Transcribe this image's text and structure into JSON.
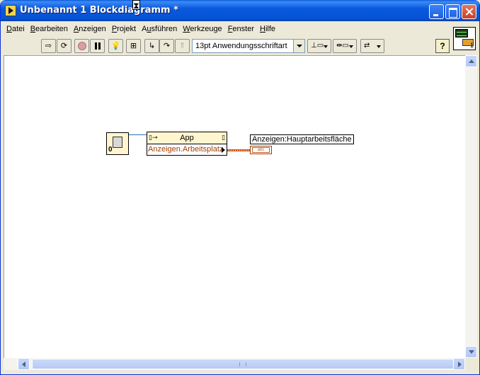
{
  "window": {
    "title": "Unbenannt 1 Blockdiagramm *"
  },
  "menu": [
    {
      "label": "Datei",
      "u": "D"
    },
    {
      "label": "Bearbeiten",
      "u": "B"
    },
    {
      "label": "Anzeigen",
      "u": "A"
    },
    {
      "label": "Projekt",
      "u": "P"
    },
    {
      "label": "Ausführen",
      "u": "u"
    },
    {
      "label": "Werkzeuge",
      "u": "W"
    },
    {
      "label": "Fenster",
      "u": "F"
    },
    {
      "label": "Hilfe",
      "u": "H"
    }
  ],
  "toolbar": {
    "font": "13pt Anwendungsschriftart",
    "help": "?"
  },
  "vi_icon": {
    "connector_label": "1"
  },
  "diagram": {
    "ref_label": "0",
    "prop_class": "App",
    "prop_property": "Anzeigen.Arbeitsplatz",
    "indicator_label": "Anzeigen:Hauptarbeitsfläche",
    "indicator_type": "abc"
  },
  "colors": {
    "title_bar": "#0553d4",
    "string_wire": "#c45a1e",
    "ref_wire": "#2f6fb7",
    "node_header": "#fff6d0"
  }
}
